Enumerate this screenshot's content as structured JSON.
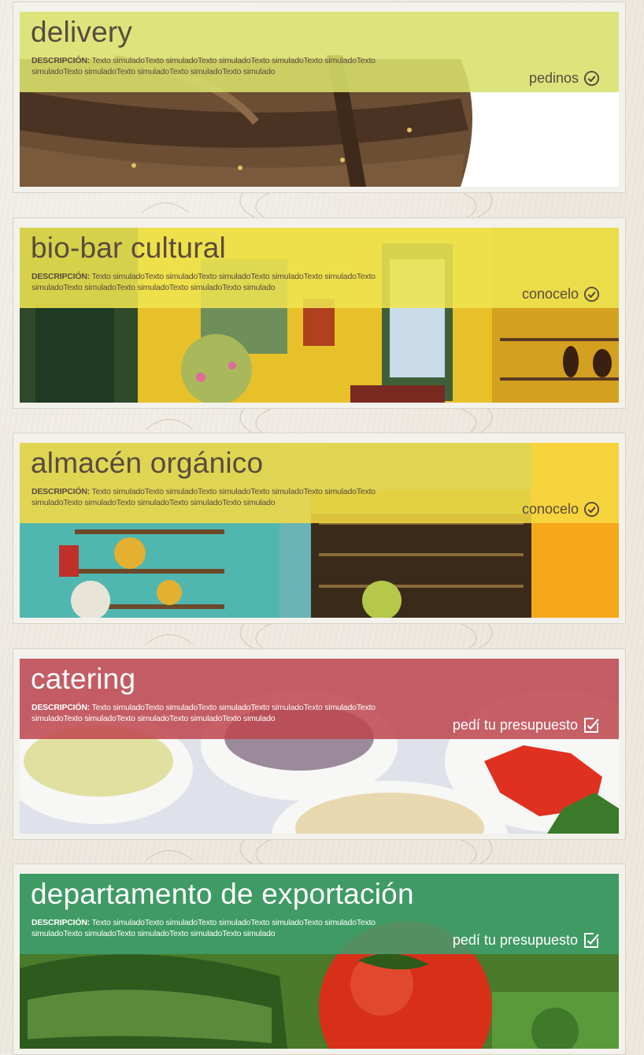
{
  "colors": {
    "delivery_band": "#d8e06a",
    "biobar_band": "#eee44e",
    "almacen_band": "#f7da43",
    "catering_band": "#be464e",
    "export_band": "#3ea06e",
    "dark_text": "#5a4a3e"
  },
  "sections": [
    {
      "title": "delivery",
      "desc_label": "DESCRIPCIÓN:",
      "desc_text": " Texto simuladoTexto simuladoTexto simuladoTexto simuladoTexto simuladoTexto simuladoTexto simuladoTexto simuladoTexto simuladoTexto simulado",
      "action_label": "pedinos",
      "action_icon": "check-circle-icon",
      "photo": "wooden-basket"
    },
    {
      "title": "bio-bar cultural",
      "desc_label": "DESCRIPCIÓN:",
      "desc_text": " Texto simuladoTexto simuladoTexto simuladoTexto simuladoTexto simuladoTexto simuladoTexto simuladoTexto simuladoTexto simuladoTexto simulado",
      "action_label": "conocelo",
      "action_icon": "check-circle-icon",
      "photo": "bar-interior"
    },
    {
      "title": "almacén orgánico",
      "desc_label": "DESCRIPCIÓN:",
      "desc_text": " Texto simuladoTexto simuladoTexto simuladoTexto simuladoTexto simuladoTexto simuladoTexto simuladoTexto simuladoTexto simuladoTexto simulado",
      "action_label": "conocelo",
      "action_icon": "check-circle-icon",
      "photo": "store-shelves"
    },
    {
      "title": "catering",
      "desc_label": "DESCRIPCIÓN:",
      "desc_text": " Texto simuladoTexto simuladoTexto simuladoTexto simuladoTexto simuladoTexto simuladoTexto simuladoTexto simuladoTexto simuladoTexto simulado",
      "action_label": "pedí tu presupuesto",
      "action_icon": "edit-checklist-icon",
      "photo": "sauce-bowls"
    },
    {
      "title": "departamento de exportación",
      "desc_label": "DESCRIPCIÓN:",
      "desc_text": " Texto simuladoTexto simuladoTexto simuladoTexto simuladoTexto simuladoTexto simuladoTexto simuladoTexto simuladoTexto simuladoTexto simulado",
      "action_label": "pedí tu presupuesto",
      "action_icon": "edit-checklist-icon",
      "photo": "vegetables"
    }
  ]
}
